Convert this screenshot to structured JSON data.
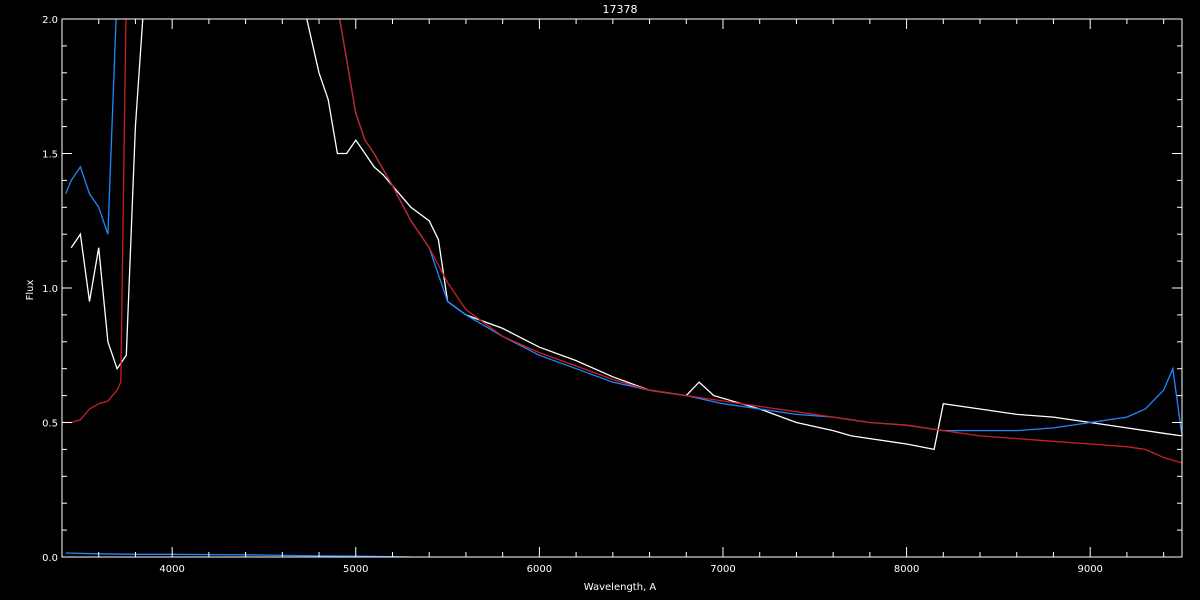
{
  "chart_data": {
    "type": "line",
    "title": "17378",
    "xlabel": "Wavelength, A",
    "ylabel": "Flux",
    "xlim": [
      3400,
      9500
    ],
    "ylim": [
      0.0,
      2.0
    ],
    "x_ticks": [
      4000,
      5000,
      6000,
      7000,
      8000,
      9000
    ],
    "x_tick_labels": [
      "4000",
      "5000",
      "6000",
      "7000",
      "8000",
      "9000"
    ],
    "y_ticks": [
      0.0,
      0.5,
      1.0,
      1.5,
      2.0
    ],
    "y_tick_labels": [
      "0.0",
      "0.5",
      "1.0",
      "1.5",
      "2.0"
    ],
    "grid": false,
    "background_color": "#000000",
    "series": [
      {
        "color": "#ffffff",
        "x": [
          3450,
          3500,
          3550,
          3600,
          3650,
          3700,
          3750,
          3800,
          3850,
          3900,
          4000,
          4100,
          4200,
          4300,
          4400,
          4500,
          4600,
          4700,
          4800,
          4850,
          4900,
          4950,
          5000,
          5050,
          5100,
          5150,
          5200,
          5300,
          5400,
          5450,
          5500,
          5600,
          5800,
          6000,
          6200,
          6400,
          6600,
          6800,
          6870,
          6950,
          7200,
          7400,
          7600,
          7700,
          7800,
          8000,
          8150,
          8200,
          8400,
          8600,
          8800,
          9000,
          9200,
          9400,
          9500
        ],
        "y": [
          1.15,
          1.2,
          0.95,
          1.15,
          0.8,
          0.7,
          0.75,
          1.6,
          2.1,
          2.1,
          2.1,
          2.1,
          2.1,
          2.1,
          2.1,
          2.1,
          2.1,
          2.1,
          1.8,
          1.7,
          1.5,
          1.5,
          1.55,
          1.5,
          1.45,
          1.42,
          1.38,
          1.3,
          1.25,
          1.18,
          0.95,
          0.9,
          0.85,
          0.78,
          0.73,
          0.67,
          0.62,
          0.6,
          0.65,
          0.6,
          0.55,
          0.5,
          0.47,
          0.45,
          0.44,
          0.42,
          0.4,
          0.57,
          0.55,
          0.53,
          0.52,
          0.5,
          0.48,
          0.46,
          0.45
        ]
      },
      {
        "color": "#1e88ff",
        "x": [
          3420,
          3450,
          3500,
          3550,
          3600,
          3650,
          3700,
          3750,
          3800,
          3850,
          3900,
          4000,
          4100,
          4200,
          4300,
          4400,
          4500,
          4600,
          4700,
          4800,
          4850,
          4900,
          4950,
          5000,
          5050,
          5100,
          5200,
          5300,
          5400,
          5500,
          5600,
          5800,
          6000,
          6200,
          6400,
          6600,
          6800,
          7000,
          7200,
          7400,
          7600,
          7700,
          7800,
          8000,
          8200,
          8400,
          8600,
          8800,
          9000,
          9200,
          9300,
          9400,
          9450,
          9500
        ],
        "y": [
          1.35,
          1.4,
          1.45,
          1.35,
          1.3,
          1.2,
          2.1,
          2.1,
          2.1,
          2.1,
          2.1,
          2.1,
          2.1,
          2.1,
          2.1,
          2.1,
          2.1,
          2.1,
          2.1,
          2.1,
          2.1,
          2.05,
          1.85,
          1.65,
          1.55,
          1.5,
          1.38,
          1.25,
          1.15,
          0.95,
          0.9,
          0.82,
          0.75,
          0.7,
          0.65,
          0.62,
          0.6,
          0.57,
          0.55,
          0.53,
          0.52,
          0.51,
          0.5,
          0.49,
          0.47,
          0.47,
          0.47,
          0.48,
          0.5,
          0.52,
          0.55,
          0.62,
          0.7,
          0.45
        ]
      },
      {
        "color": "#cc2020",
        "x": [
          3400,
          3450,
          3500,
          3550,
          3600,
          3650,
          3700,
          3720,
          3750,
          3800,
          3850,
          4870,
          4900,
          4950,
          5000,
          5050,
          5100,
          5200,
          5300,
          5400,
          5500,
          5600,
          5800,
          6000,
          6200,
          6400,
          6600,
          6800,
          7000,
          7200,
          7400,
          7600,
          7800,
          8000,
          8200,
          8400,
          8600,
          8800,
          9000,
          9200,
          9300,
          9400,
          9500
        ],
        "y": [
          0.5,
          0.5,
          0.51,
          0.55,
          0.57,
          0.58,
          0.62,
          0.65,
          2.1,
          2.1,
          2.1,
          2.1,
          2.05,
          1.85,
          1.65,
          1.55,
          1.5,
          1.38,
          1.25,
          1.15,
          1.02,
          0.92,
          0.82,
          0.76,
          0.71,
          0.66,
          0.62,
          0.6,
          0.58,
          0.56,
          0.54,
          0.52,
          0.5,
          0.49,
          0.47,
          0.45,
          0.44,
          0.43,
          0.42,
          0.41,
          0.4,
          0.37,
          0.35
        ]
      },
      {
        "color": "#1e88ff",
        "x": [
          3420,
          3600,
          3800,
          4000,
          4200,
          4400,
          4600,
          4800,
          5000,
          5200,
          5300
        ],
        "y": [
          0.015,
          0.012,
          0.01,
          0.01,
          0.009,
          0.008,
          0.006,
          0.004,
          0.003,
          0.001,
          0.0
        ]
      }
    ]
  }
}
